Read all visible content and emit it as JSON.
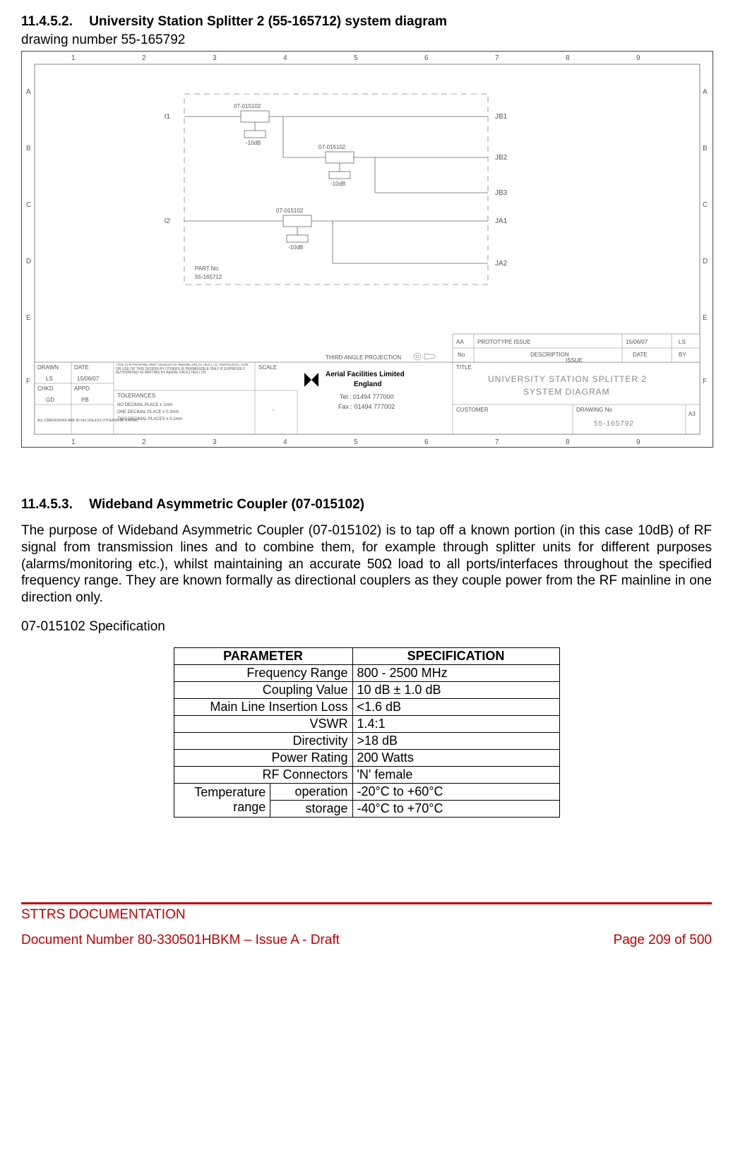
{
  "section1": {
    "number": "11.4.5.2.",
    "title": "University Station Splitter 2 (55-165712) system diagram",
    "drawing_ref": "drawing number 55-165792"
  },
  "diagram": {
    "inputs": [
      "I1",
      "I2"
    ],
    "outputs": [
      "JB1",
      "JB2",
      "JB3",
      "JA1",
      "JA2"
    ],
    "coupler_part": "07-015102",
    "coupler_atten": "-10dB",
    "part_no_label": "PART No.",
    "part_no": "55-165712",
    "titleblock": {
      "rev": "AA",
      "rev_desc": "PROTOTYPE ISSUE",
      "rev_date": "15/06/07",
      "rev_by": "LS",
      "issue_header_no": "No",
      "issue_header_desc": "DESCRIPTION",
      "issue_header_date": "DATE",
      "issue_header_by": "BY",
      "issue_label": "ISSUE",
      "drawn_h": "DRAWN",
      "drawn": "LS",
      "date_h": "DATE",
      "date": "15/06/07",
      "chkd_h": "CHKD",
      "chkd": "GD",
      "appd_h": "APPD",
      "appd": "PB",
      "dims": "ALL DIMENSIONS ARE IN mm UNLESS OTHERWISE STATED",
      "prop": "THIS IS A PROPRIETARY DESIGN OF AERIAL FACILITIES LTD. REPRODUCTION OR USE OF THIS DESIGN BY OTHERS IS PERMISSIBLE ONLY IF EXPRESSLY AUTHORISED IN WRITING BY AERIAL FACILITIES LTD.",
      "tol_h": "TOLERANCES",
      "tol1": "NO DECIMAL PLACE ± 1mm",
      "tol2": "ONE DECIMAL PLACE ± 0.3mm",
      "tol3": "TWO DECIMAL PLACES ± 0.1mm",
      "scale_h": "SCALE",
      "scale": "-",
      "proj": "THIRD ANGLE PROJECTION",
      "company": "Aerial Facilities Limited",
      "country": "England",
      "tel": "Tel : 01494 777000",
      "fax": "Fax : 01494 777002",
      "title_h": "TITLE",
      "title1": "UNIVERSITY STATION SPLITTER 2",
      "title2": "SYSTEM DIAGRAM",
      "cust_h": "CUSTOMER",
      "dwg_h": "DRAWING No",
      "dwg": "55-165792",
      "sheet": "A3"
    },
    "grid_cols": [
      "1",
      "2",
      "3",
      "4",
      "5",
      "6",
      "7",
      "8",
      "9"
    ],
    "grid_rows": [
      "A",
      "B",
      "C",
      "D",
      "E",
      "F"
    ]
  },
  "section2": {
    "number": "11.4.5.3.",
    "title": "Wideband Asymmetric Coupler (07-015102)"
  },
  "paragraph": "The purpose of Wideband Asymmetric Coupler (07-015102) is to tap off a known portion (in this case 10dB) of RF signal from transmission lines and to combine them, for example through splitter units for different purposes (alarms/monitoring etc.), whilst maintaining an accurate 50Ω load to all ports/interfaces throughout the specified frequency range. They are known formally as directional couplers as they couple power from the RF mainline in one direction only.",
  "spec_title": "07-015102 Specification",
  "table": {
    "head_param": "PARAMETER",
    "head_spec": "SPECIFICATION",
    "rows": [
      {
        "param": "Frequency Range",
        "spec": "800 - 2500 MHz"
      },
      {
        "param": "Coupling Value",
        "spec": "10 dB ± 1.0 dB"
      },
      {
        "param": "Main Line Insertion Loss",
        "spec": "<1.6 dB"
      },
      {
        "param": "VSWR",
        "spec": "1.4:1"
      },
      {
        "param": "Directivity",
        "spec": ">18 dB"
      },
      {
        "param": "Power Rating",
        "spec": "200 Watts"
      },
      {
        "param": "RF Connectors",
        "spec": "'N' female"
      }
    ],
    "temp_label": "Temperature range",
    "temp_op_label": "operation",
    "temp_op_val": "-20°C to +60°C",
    "temp_st_label": "storage",
    "temp_st_val": "-40°C to +70°C"
  },
  "footer": {
    "line1": "STTRS DOCUMENTATION",
    "doc": "Document Number 80-330501HBKM – Issue A - Draft",
    "page": "Page 209 of 500"
  }
}
